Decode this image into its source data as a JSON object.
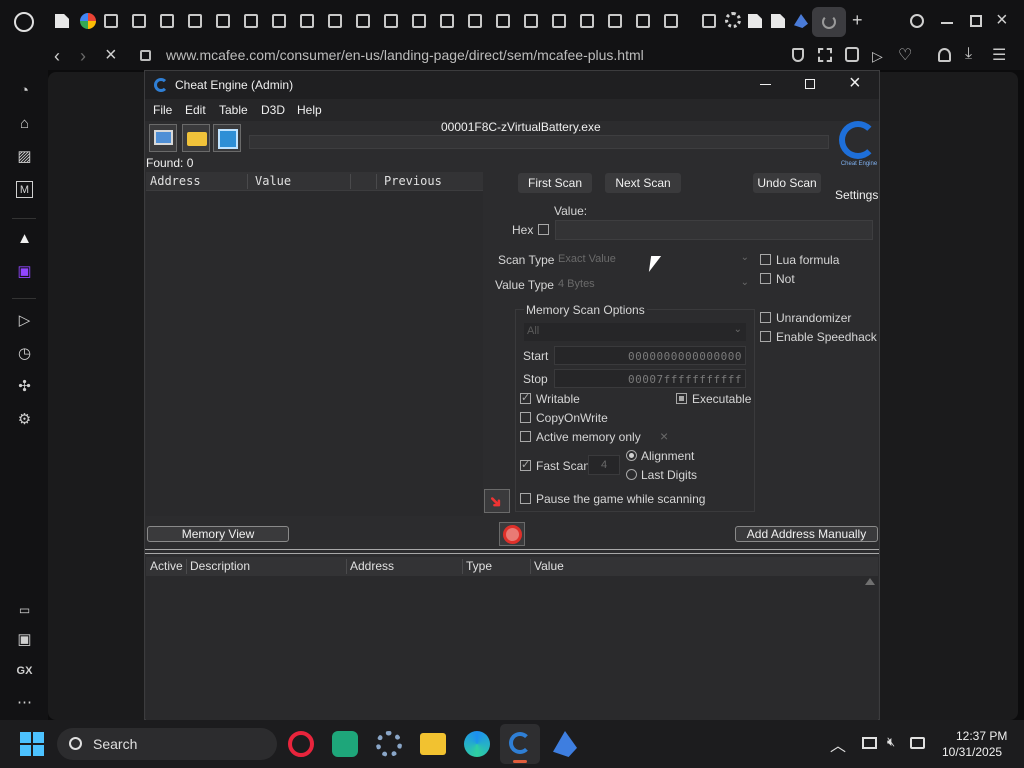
{
  "browser": {
    "url": "www.mcafee.com/consumer/en-us/landing-page/direct/sem/mcafee-plus.html"
  },
  "window": {
    "title": "Cheat Engine (Admin)",
    "menu": [
      "File",
      "Edit",
      "Table",
      "D3D",
      "Help"
    ],
    "process": "00001F8C-zVirtualBattery.exe",
    "found": "Found: 0",
    "logo_text": "Cheat Engine",
    "settings": "Settings"
  },
  "scan_list": {
    "columns": [
      "Address",
      "Value",
      "Previous"
    ]
  },
  "scan": {
    "first": "First Scan",
    "next": "Next Scan",
    "undo": "Undo Scan",
    "value_label": "Value:",
    "hex": "Hex",
    "scan_type_label": "Scan Type",
    "scan_type": "Exact Value",
    "value_type_label": "Value Type",
    "value_type": "4 Bytes",
    "lua_formula": "Lua formula",
    "not": "Not",
    "unrandomizer": "Unrandomizer",
    "speedhack": "Enable Speedhack"
  },
  "memory": {
    "title": "Memory Scan Options",
    "region": "All",
    "start_label": "Start",
    "start": "0000000000000000",
    "stop_label": "Stop",
    "stop": "00007fffffffffff",
    "writable": "Writable",
    "executable": "Executable",
    "copyonwrite": "CopyOnWrite",
    "active_memory": "Active memory only",
    "fast_scan": "Fast Scan",
    "fast_scan_value": "4",
    "alignment": "Alignment",
    "last_digits": "Last Digits",
    "pause": "Pause the game while scanning"
  },
  "buttons": {
    "memory_view": "Memory View",
    "add_address": "Add Address Manually"
  },
  "address_table": {
    "columns": [
      "Active",
      "Description",
      "Address",
      "Type",
      "Value"
    ]
  },
  "taskbar": {
    "search": "Search",
    "time": "12:37 PM",
    "date": "10/31/2025"
  },
  "sidebar": {
    "gx": "GX"
  },
  "colors": {
    "window_bg": "#2c2c2e",
    "title_bg": "#1f1f21",
    "accent": "#1e6fd9"
  }
}
